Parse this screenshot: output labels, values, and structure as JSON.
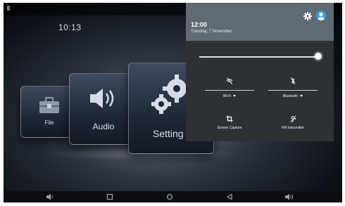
{
  "launcher": {
    "clock": "10:13",
    "cards": [
      {
        "label": "File",
        "icon": "toolbox-icon"
      },
      {
        "label": "Audio",
        "icon": "speaker-icon"
      },
      {
        "label": "Setting",
        "icon": "gears-icon"
      }
    ]
  },
  "quick_settings": {
    "time": "12:00",
    "date": "Tuesday, 7 November",
    "settings_icon": "gear-icon",
    "user_icon": "user-icon",
    "brightness_level": 1.0,
    "tiles": [
      {
        "label": "Wi-Fi",
        "icon": "wifi-off-icon",
        "has_dropdown": true
      },
      {
        "label": "Bluetooth",
        "icon": "bluetooth-off-icon",
        "has_dropdown": true
      },
      {
        "label": "Screen Capture",
        "icon": "screen-capture-icon",
        "has_dropdown": false
      },
      {
        "label": "FM transmitter",
        "icon": "fm-transmitter-icon",
        "has_dropdown": false
      }
    ]
  },
  "navbar": {
    "buttons": [
      "volume-down-icon",
      "recents-icon",
      "home-icon",
      "back-icon",
      "volume-up-icon"
    ]
  },
  "colors": {
    "header": "#5f6a73",
    "panel": "#2d3134",
    "user_accent": "#2ca5e8"
  }
}
